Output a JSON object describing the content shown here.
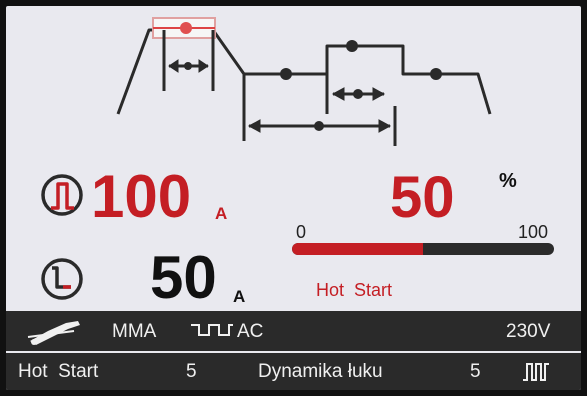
{
  "diagram": {
    "icon": "hot-start-waveform-diagram"
  },
  "main_current": {
    "icon": "peak-current-icon",
    "value": "100",
    "unit": "A",
    "color": "#c41e24"
  },
  "base_current": {
    "icon": "base-current-icon",
    "value": "50",
    "unit": "A",
    "color": "#111111"
  },
  "hot_start": {
    "value": "50",
    "unit": "%",
    "min": "0",
    "max": "100",
    "label": "Hot  Start",
    "level_percent": 50,
    "fill_color": "#c41e24",
    "track_color": "#2b2b2b"
  },
  "status_bar": {
    "electrode_icon": "electrode-holder-icon",
    "mode": "MMA",
    "waveform_icon": "ac-square-wave-icon",
    "current_type": "AC",
    "voltage": "230V"
  },
  "params_bar": {
    "hot_start_label": "Hot  Start",
    "hot_start_value": "5",
    "arc_force_label": "Dynamika łuku",
    "arc_force_value": "5",
    "pulse_icon": "pulse-waveform-icon"
  }
}
